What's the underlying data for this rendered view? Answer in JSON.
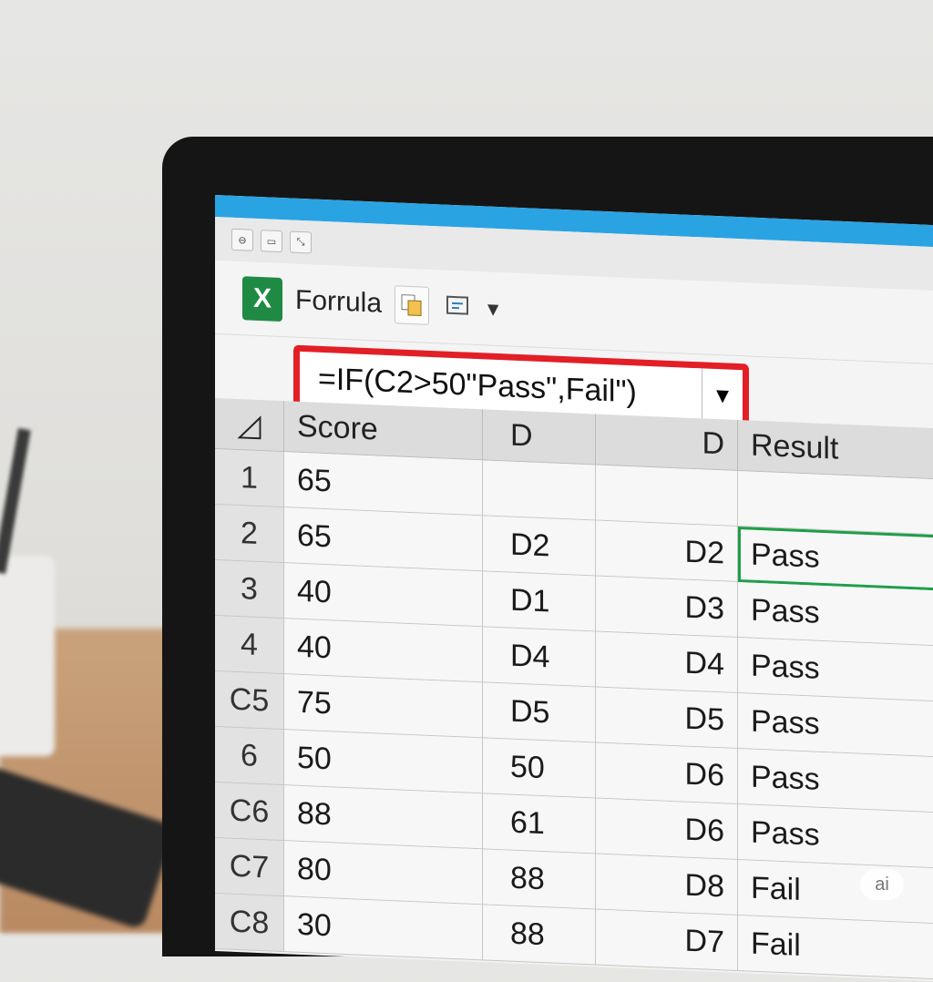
{
  "window": {
    "controls": [
      "⊖",
      "▭",
      "⤡"
    ]
  },
  "ribbon": {
    "app_icon": "excel-icon",
    "label": "Forrula"
  },
  "formula_bar": {
    "value": "=IF(C2>50\"Pass\",Fail\")"
  },
  "sheet": {
    "headers": [
      "Score",
      "D",
      "D",
      "Result"
    ],
    "rows": [
      {
        "row": "1",
        "score": "65",
        "d1": "",
        "d2": "",
        "result": ""
      },
      {
        "row": "2",
        "score": "65",
        "d1": "D2",
        "d2": "D2",
        "result": "Pass"
      },
      {
        "row": "3",
        "score": "40",
        "d1": "D1",
        "d2": "D3",
        "result": "Pass"
      },
      {
        "row": "4",
        "score": "40",
        "d1": "D4",
        "d2": "D4",
        "result": "Pass"
      },
      {
        "row": "C5",
        "score": "75",
        "d1": "D5",
        "d2": "D5",
        "result": "Pass"
      },
      {
        "row": "6",
        "score": "50",
        "d1": "50",
        "d2": "D6",
        "result": "Pass"
      },
      {
        "row": "C6",
        "score": "88",
        "d1": "61",
        "d2": "D6",
        "result": "Pass"
      },
      {
        "row": "C7",
        "score": "80",
        "d1": "88",
        "d2": "D8",
        "result": "Fail"
      },
      {
        "row": "C8",
        "score": "30",
        "d1": "88",
        "d2": "D7",
        "result": "Fail"
      }
    ]
  },
  "badge": "ai"
}
